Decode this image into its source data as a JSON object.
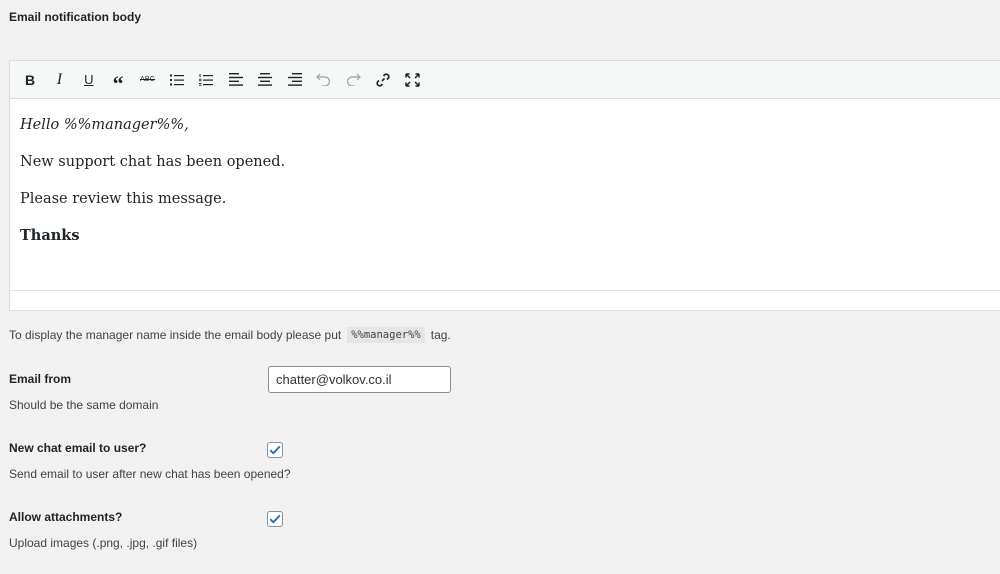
{
  "section": {
    "title": "Email notification body"
  },
  "toolbar": {
    "buttons": [
      {
        "name": "bold",
        "glyph": "B"
      },
      {
        "name": "italic",
        "glyph": "I"
      },
      {
        "name": "underline",
        "glyph": "U"
      },
      {
        "name": "blockquote",
        "glyph": "“"
      },
      {
        "name": "strikethrough",
        "glyph": "ABC"
      },
      {
        "name": "bulleted-list",
        "icon": "bulleted-list-icon"
      },
      {
        "name": "numbered-list",
        "icon": "numbered-list-icon"
      },
      {
        "name": "align-left",
        "icon": "align-left-icon"
      },
      {
        "name": "align-center",
        "icon": "align-center-icon"
      },
      {
        "name": "align-right",
        "icon": "align-right-icon"
      },
      {
        "name": "undo",
        "icon": "undo-icon",
        "disabled": true
      },
      {
        "name": "redo",
        "icon": "redo-icon",
        "disabled": true
      },
      {
        "name": "link",
        "icon": "link-icon"
      },
      {
        "name": "fullscreen",
        "icon": "fullscreen-icon"
      }
    ]
  },
  "editor": {
    "line1": "Hello %%manager%%,",
    "line2": "New support chat has been opened.",
    "line3": "Please review this message.",
    "line4": "Thanks"
  },
  "hint": {
    "before": "To display the manager name inside the email body please put",
    "tag": "%%manager%%",
    "after": "tag."
  },
  "email_from": {
    "label": "Email from",
    "description": "Should be the same domain",
    "value": "chatter@volkov.co.il"
  },
  "new_chat_email": {
    "label": "New chat email to user?",
    "description": "Send email to user after new chat has been opened?",
    "checked": true
  },
  "allow_attachments": {
    "label": "Allow attachments?",
    "description": "Upload images (.png, .jpg, .gif files)",
    "checked": true
  },
  "colors": {
    "checkmark": "#2271b1",
    "background": "#f1f1f1"
  }
}
